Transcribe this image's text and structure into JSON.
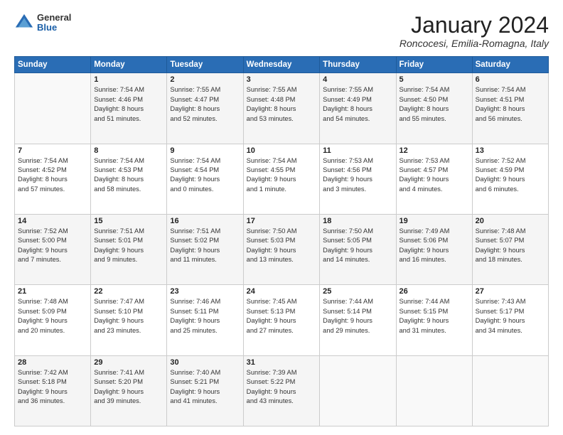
{
  "header": {
    "logo": {
      "line1": "General",
      "line2": "Blue"
    },
    "title": "January 2024",
    "subtitle": "Roncocesi, Emilia-Romagna, Italy"
  },
  "days_header": [
    "Sunday",
    "Monday",
    "Tuesday",
    "Wednesday",
    "Thursday",
    "Friday",
    "Saturday"
  ],
  "weeks": [
    [
      {
        "day": "",
        "info": ""
      },
      {
        "day": "1",
        "info": "Sunrise: 7:54 AM\nSunset: 4:46 PM\nDaylight: 8 hours\nand 51 minutes."
      },
      {
        "day": "2",
        "info": "Sunrise: 7:55 AM\nSunset: 4:47 PM\nDaylight: 8 hours\nand 52 minutes."
      },
      {
        "day": "3",
        "info": "Sunrise: 7:55 AM\nSunset: 4:48 PM\nDaylight: 8 hours\nand 53 minutes."
      },
      {
        "day": "4",
        "info": "Sunrise: 7:55 AM\nSunset: 4:49 PM\nDaylight: 8 hours\nand 54 minutes."
      },
      {
        "day": "5",
        "info": "Sunrise: 7:54 AM\nSunset: 4:50 PM\nDaylight: 8 hours\nand 55 minutes."
      },
      {
        "day": "6",
        "info": "Sunrise: 7:54 AM\nSunset: 4:51 PM\nDaylight: 8 hours\nand 56 minutes."
      }
    ],
    [
      {
        "day": "7",
        "info": "Sunrise: 7:54 AM\nSunset: 4:52 PM\nDaylight: 8 hours\nand 57 minutes."
      },
      {
        "day": "8",
        "info": "Sunrise: 7:54 AM\nSunset: 4:53 PM\nDaylight: 8 hours\nand 58 minutes."
      },
      {
        "day": "9",
        "info": "Sunrise: 7:54 AM\nSunset: 4:54 PM\nDaylight: 9 hours\nand 0 minutes."
      },
      {
        "day": "10",
        "info": "Sunrise: 7:54 AM\nSunset: 4:55 PM\nDaylight: 9 hours\nand 1 minute."
      },
      {
        "day": "11",
        "info": "Sunrise: 7:53 AM\nSunset: 4:56 PM\nDaylight: 9 hours\nand 3 minutes."
      },
      {
        "day": "12",
        "info": "Sunrise: 7:53 AM\nSunset: 4:57 PM\nDaylight: 9 hours\nand 4 minutes."
      },
      {
        "day": "13",
        "info": "Sunrise: 7:52 AM\nSunset: 4:59 PM\nDaylight: 9 hours\nand 6 minutes."
      }
    ],
    [
      {
        "day": "14",
        "info": "Sunrise: 7:52 AM\nSunset: 5:00 PM\nDaylight: 9 hours\nand 7 minutes."
      },
      {
        "day": "15",
        "info": "Sunrise: 7:51 AM\nSunset: 5:01 PM\nDaylight: 9 hours\nand 9 minutes."
      },
      {
        "day": "16",
        "info": "Sunrise: 7:51 AM\nSunset: 5:02 PM\nDaylight: 9 hours\nand 11 minutes."
      },
      {
        "day": "17",
        "info": "Sunrise: 7:50 AM\nSunset: 5:03 PM\nDaylight: 9 hours\nand 13 minutes."
      },
      {
        "day": "18",
        "info": "Sunrise: 7:50 AM\nSunset: 5:05 PM\nDaylight: 9 hours\nand 14 minutes."
      },
      {
        "day": "19",
        "info": "Sunrise: 7:49 AM\nSunset: 5:06 PM\nDaylight: 9 hours\nand 16 minutes."
      },
      {
        "day": "20",
        "info": "Sunrise: 7:48 AM\nSunset: 5:07 PM\nDaylight: 9 hours\nand 18 minutes."
      }
    ],
    [
      {
        "day": "21",
        "info": "Sunrise: 7:48 AM\nSunset: 5:09 PM\nDaylight: 9 hours\nand 20 minutes."
      },
      {
        "day": "22",
        "info": "Sunrise: 7:47 AM\nSunset: 5:10 PM\nDaylight: 9 hours\nand 23 minutes."
      },
      {
        "day": "23",
        "info": "Sunrise: 7:46 AM\nSunset: 5:11 PM\nDaylight: 9 hours\nand 25 minutes."
      },
      {
        "day": "24",
        "info": "Sunrise: 7:45 AM\nSunset: 5:13 PM\nDaylight: 9 hours\nand 27 minutes."
      },
      {
        "day": "25",
        "info": "Sunrise: 7:44 AM\nSunset: 5:14 PM\nDaylight: 9 hours\nand 29 minutes."
      },
      {
        "day": "26",
        "info": "Sunrise: 7:44 AM\nSunset: 5:15 PM\nDaylight: 9 hours\nand 31 minutes."
      },
      {
        "day": "27",
        "info": "Sunrise: 7:43 AM\nSunset: 5:17 PM\nDaylight: 9 hours\nand 34 minutes."
      }
    ],
    [
      {
        "day": "28",
        "info": "Sunrise: 7:42 AM\nSunset: 5:18 PM\nDaylight: 9 hours\nand 36 minutes."
      },
      {
        "day": "29",
        "info": "Sunrise: 7:41 AM\nSunset: 5:20 PM\nDaylight: 9 hours\nand 39 minutes."
      },
      {
        "day": "30",
        "info": "Sunrise: 7:40 AM\nSunset: 5:21 PM\nDaylight: 9 hours\nand 41 minutes."
      },
      {
        "day": "31",
        "info": "Sunrise: 7:39 AM\nSunset: 5:22 PM\nDaylight: 9 hours\nand 43 minutes."
      },
      {
        "day": "",
        "info": ""
      },
      {
        "day": "",
        "info": ""
      },
      {
        "day": "",
        "info": ""
      }
    ]
  ]
}
